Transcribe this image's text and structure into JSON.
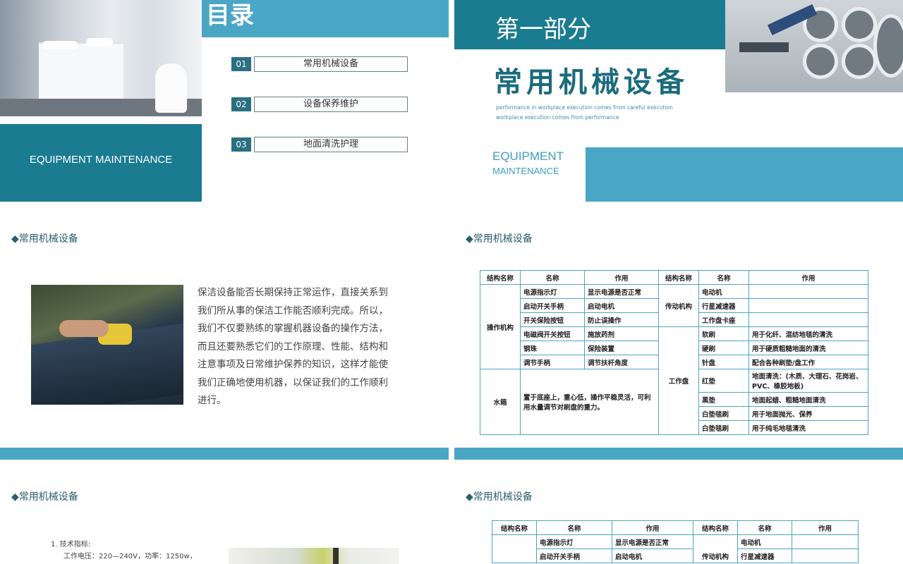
{
  "slide1": {
    "brand": "EQUIPMENT MAINTENANCE"
  },
  "slide2": {
    "title": "目录",
    "items": [
      {
        "num": "01",
        "label": "常用机械设备"
      },
      {
        "num": "02",
        "label": "设备保养维护"
      },
      {
        "num": "03",
        "label": "地面清洗护理"
      }
    ]
  },
  "slide3": {
    "part": "第一部分",
    "title": "常用机械设备",
    "sub1": "performance in workplace execution comes from careful execution",
    "sub2": "workplace execution comes from performance",
    "en1": "EQUIPMENT",
    "en2": "MAINTENANCE"
  },
  "section_heading": "◆常用机械设备",
  "slide4": {
    "paragraph": "保洁设备能否长期保持正常运作，直接关系到我们所从事的保洁工作能否顺利完成。所以，我们不仅要熟练的掌握机器设备的操作方法，而且还要熟悉它们的工作原理、性能、结构和注意事项及日常维护保养的知识，这样才能使我们正确地使用机器，以保证我们的工作顺利进行。"
  },
  "table": {
    "headers": [
      "结构名称",
      "名称",
      "作用",
      "结构名称",
      "名称",
      "作用"
    ],
    "left_group1": "操作机构",
    "left_rows": [
      {
        "name": "电源指示灯",
        "use": "显示电源是否正常"
      },
      {
        "name": "启动开关手柄",
        "use": "启动电机"
      },
      {
        "name": "开关保险按钮",
        "use": "防止误操作"
      },
      {
        "name": "电磁阀开关按钮",
        "use": "施放药剂"
      },
      {
        "name": "钢珠",
        "use": "保险装置"
      },
      {
        "name": "调节手柄",
        "use": "调节扶杆角度"
      }
    ],
    "left_group2": "水箱",
    "water_desc": "置于底座上，重心低，操作平稳灵活，可利用水量调节对刷盘的重力。",
    "right_group1": "传动机构",
    "right_rows1": [
      {
        "name": "电动机",
        "use": ""
      },
      {
        "name": "行星减速器",
        "use": ""
      },
      {
        "name": "工作盘卡座",
        "use": ""
      }
    ],
    "right_group2": "工作盘",
    "right_rows2": [
      {
        "name": "软刷",
        "use": "用于化纤、混纺地毯的清洗"
      },
      {
        "name": "硬刷",
        "use": "用于硬质粗糙地面的清洗"
      },
      {
        "name": "针盘",
        "use": "配合各种刷垫/盘工作"
      },
      {
        "name": "红垫",
        "use": "地面清洗：(木质、大理石、花岗岩、PVC、橡胶地板)"
      },
      {
        "name": "黑垫",
        "use": "地面起蜡、粗糙地面清洗"
      },
      {
        "name": "白垫毯刷",
        "use": "用于地面抛光、保养"
      },
      {
        "name": "白垫毯刷",
        "use": "用于纯毛地毯清洗"
      }
    ]
  },
  "slide5": {
    "list_title": "1.  技术指标:",
    "line1": "工作电压：220—240V，功率：1250w，"
  },
  "slide6": {
    "right_group1_label": "传动机构"
  },
  "colors": {
    "teal": "#1b7b90",
    "lightteal": "#4aa6c5",
    "dark": "#2a6f82"
  }
}
